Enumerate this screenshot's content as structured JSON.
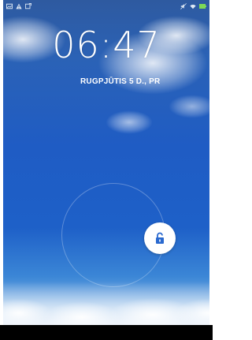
{
  "lockscreen": {
    "time": "06:47",
    "date": "RUGPJŪTIS 5 D., PR"
  },
  "status_bar": {
    "left_icons": [
      "image-notification-icon",
      "warning-icon",
      "screenshot-icon"
    ],
    "right_icons": [
      "mute-icon",
      "wifi-icon",
      "battery-icon"
    ]
  },
  "unlock": {
    "icon": "unlock-icon"
  },
  "colors": {
    "sky_top": "#2e5aa0",
    "sky_mid": "#1f5cc4",
    "sky_bottom": "#a9c9ea",
    "battery": "#7ed957"
  }
}
